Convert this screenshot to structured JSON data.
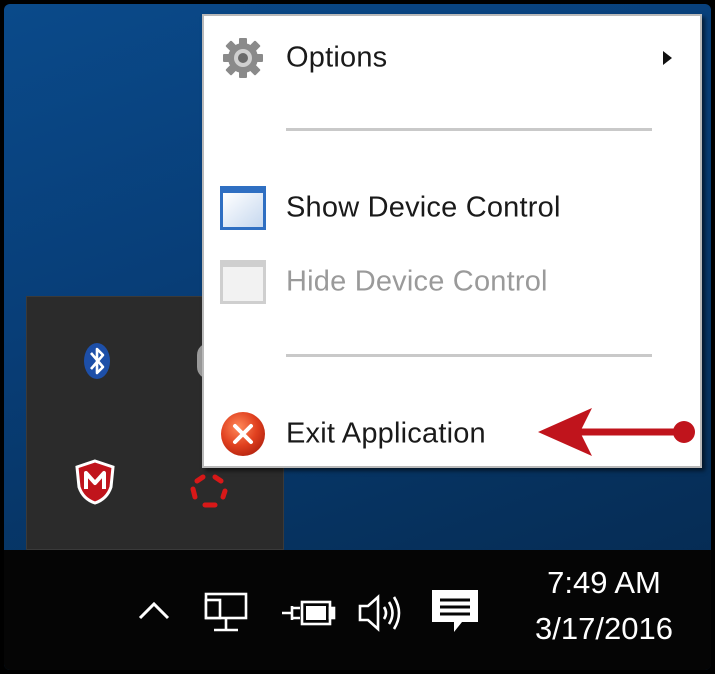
{
  "context_menu": {
    "items": [
      {
        "label": "Options",
        "icon": "gear-icon",
        "has_submenu": true,
        "enabled": true
      },
      {
        "label": "Show Device Control",
        "icon": "window-icon",
        "enabled": true
      },
      {
        "label": "Hide Device Control",
        "icon": "window-icon",
        "enabled": false
      },
      {
        "label": "Exit Application",
        "icon": "close-circle-icon",
        "enabled": true
      }
    ]
  },
  "tray_flyout": {
    "icons": [
      "bluetooth-icon",
      "mouse-icon",
      "mcafee-icon",
      "device-control-ring-icon"
    ]
  },
  "taskbar": {
    "icons": [
      "show-hidden-icons-chevron",
      "network-icon",
      "power-battery-icon",
      "volume-icon",
      "action-center-icon"
    ],
    "clock": {
      "time": "7:49 AM",
      "date": "3/17/2016"
    }
  },
  "colors": {
    "desktop": "#0a4a8a",
    "taskbar": "#050505",
    "annotation_arrow": "#c0141c",
    "exit_icon": "#e0401f"
  }
}
